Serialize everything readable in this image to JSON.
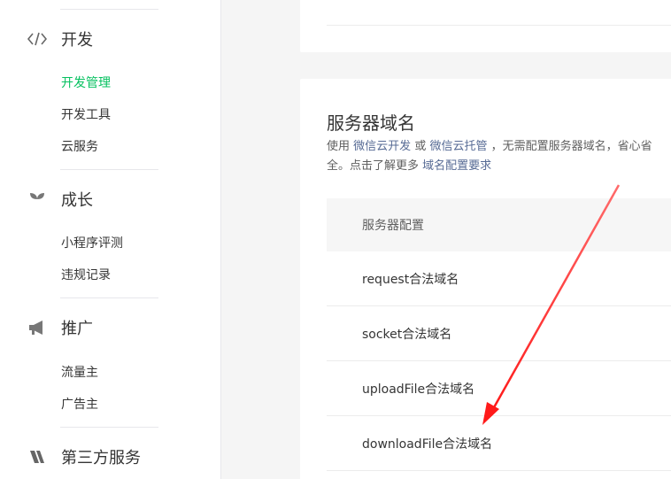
{
  "sidebar": {
    "sections": [
      {
        "label": "开发",
        "icon": "code-icon",
        "items": [
          "开发管理",
          "开发工具",
          "云服务"
        ],
        "active": 0
      },
      {
        "label": "成长",
        "icon": "sprout-icon",
        "items": [
          "小程序评测",
          "违规记录"
        ]
      },
      {
        "label": "推广",
        "icon": "megaphone-icon",
        "items": [
          "流量主",
          "广告主"
        ]
      },
      {
        "label": "第三方服务",
        "icon": "third-party-icon",
        "items": []
      }
    ]
  },
  "main": {
    "server_domain": {
      "title": "服务器域名",
      "desc": {
        "prefix": "使用",
        "link1": "微信云开发",
        "or": "或",
        "link2": "微信云托管",
        "rest": "，无需配置服务器域名，省心省",
        "line2_prefix": "全。点击了解更多",
        "link3": "域名配置要求"
      },
      "table_header": "服务器配置",
      "rows": [
        "request合法域名",
        "socket合法域名",
        "uploadFile合法域名",
        "downloadFile合法域名"
      ]
    }
  },
  "colors": {
    "accent_green": "#07c160",
    "link_blue": "#576b95",
    "arrow_red": "#ff1a1a"
  }
}
